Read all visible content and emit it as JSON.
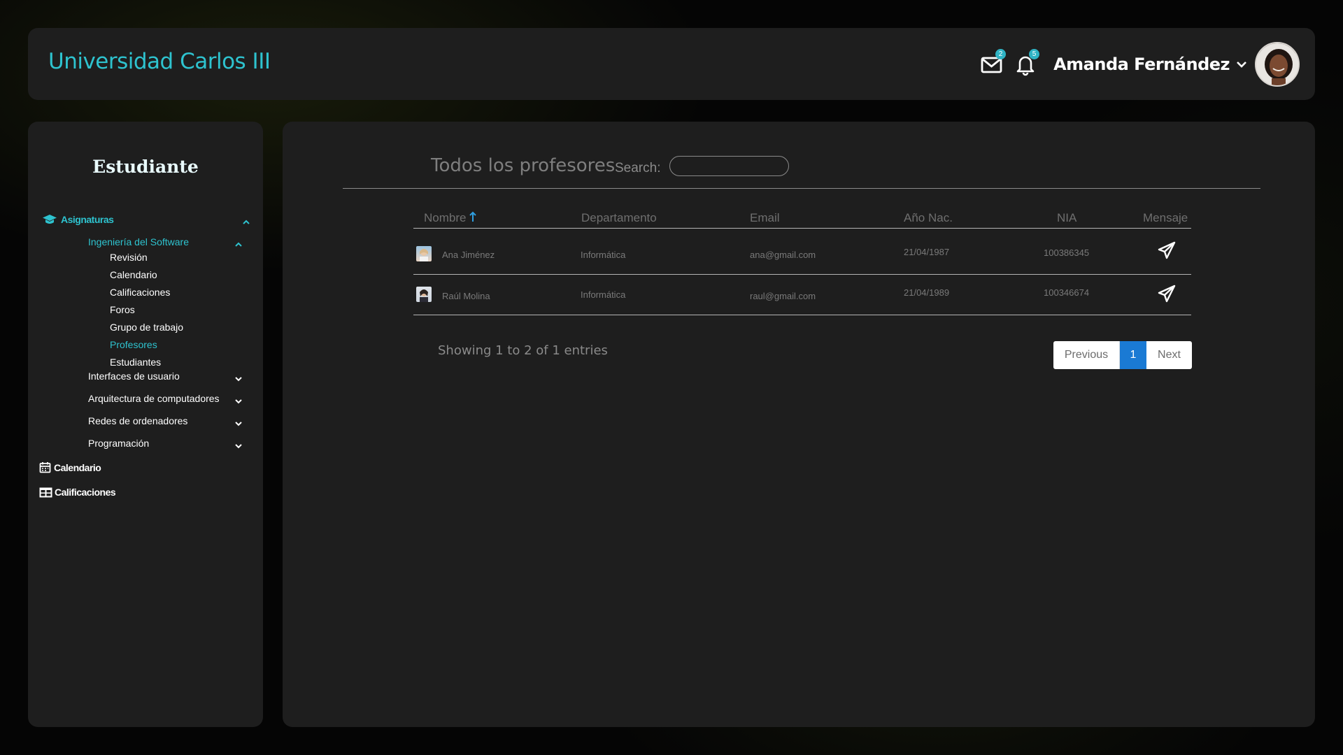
{
  "header": {
    "brand": "Universidad Carlos III",
    "mail_badge": "2",
    "bell_badge": "5",
    "user_name": "Amanda Fernández"
  },
  "sidebar": {
    "title": "Estudiante",
    "asignaturas_label": "Asignaturas",
    "course_open": "Ingeniería del Software",
    "sub_items": [
      "Revisión",
      "Calendario",
      "Calificaciones",
      "Foros",
      "Grupo de trabajo",
      "Profesores",
      "Estudiantes"
    ],
    "courses": [
      "Interfaces de usuario",
      "Arquitectura de computadores",
      "Redes de ordenadores",
      "Programación"
    ],
    "calendario_label": "Calendario",
    "calificaciones_label": "Calificaciones",
    "active_sub_item": "Profesores"
  },
  "main": {
    "title": "Todos los profesores",
    "search_label": "Search:",
    "search_value": "",
    "columns": [
      "Nombre",
      "Departamento",
      "Email",
      "Año Nac.",
      "NIA",
      "Mensaje"
    ],
    "sort_icon": "arrow-up-icon",
    "rows": [
      {
        "name": "Ana Jiménez",
        "department": "Informática",
        "email": "ana@gmail.com",
        "birth": "21/04/1987",
        "nia": "100386345"
      },
      {
        "name": "Raúl Molina",
        "department": "Informática",
        "email": "raul@gmail.com",
        "birth": "21/04/1989",
        "nia": "100346674"
      }
    ],
    "entries_text": "Showing 1 to 2 of 1 entries",
    "pager": {
      "previous": "Previous",
      "current": "1",
      "next": "Next"
    }
  },
  "colors": {
    "accent": "#2ec3cf",
    "panel": "#1e1e1e",
    "page_active": "#1a7ad4"
  }
}
